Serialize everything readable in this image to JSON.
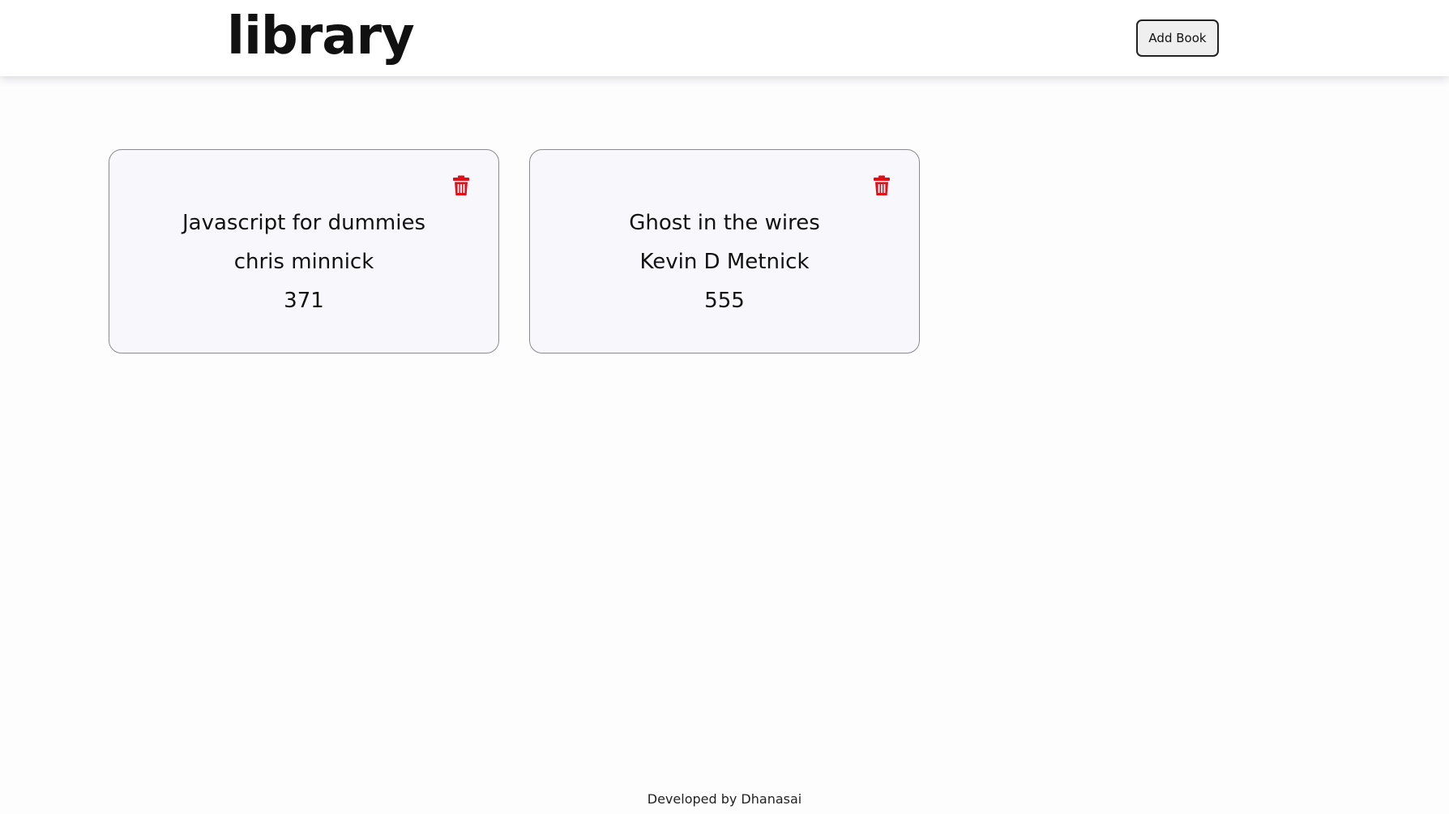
{
  "header": {
    "title": "library",
    "add_book_label": "Add Book"
  },
  "books": [
    {
      "title": "Javascript for dummies",
      "author": "chris minnick",
      "pages": "371"
    },
    {
      "title": "Ghost in the wires",
      "author": "Kevin D Metnick",
      "pages": "555"
    }
  ],
  "icons": {
    "delete": "trash-icon"
  },
  "colors": {
    "delete": "#e0101a",
    "card_bg": "#f8f8fc",
    "button_bg": "#efefef"
  },
  "footer": {
    "text": "Developed by Dhanasai"
  }
}
